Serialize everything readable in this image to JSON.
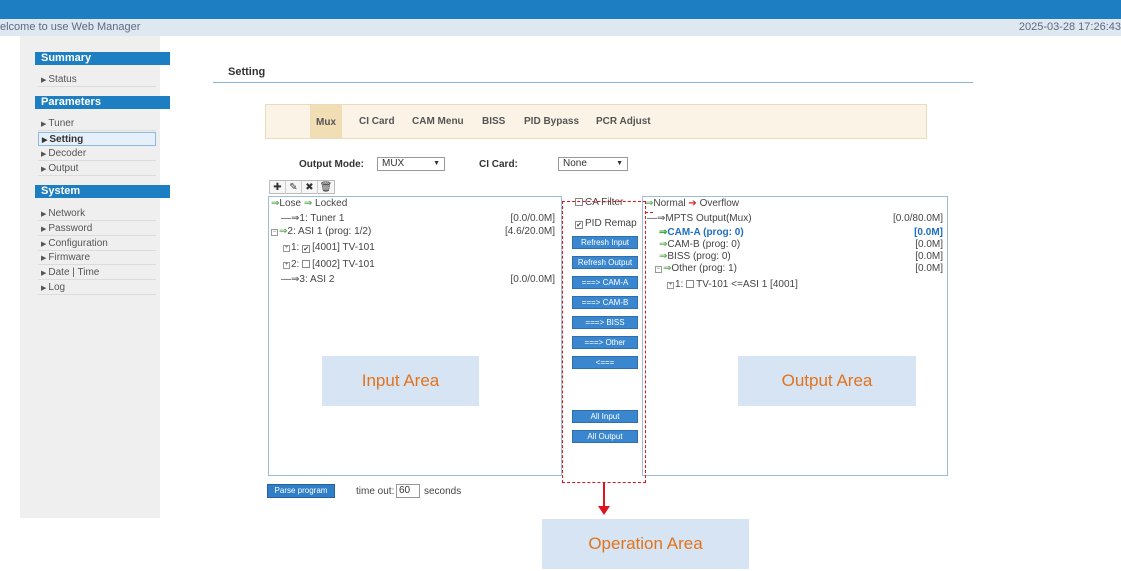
{
  "header": {
    "welcome": "elcome to use Web Manager",
    "datetime": "2025-03-28 17:26:43",
    "accent": "#1d7fc1"
  },
  "sidebar": {
    "summary_title": "Summary",
    "summary_items": [
      "Status"
    ],
    "parameters_title": "Parameters",
    "parameters_items": [
      "Tuner",
      "Setting",
      "Decoder",
      "Output"
    ],
    "system_title": "System",
    "system_items": [
      "Network",
      "Password",
      "Configuration",
      "Firmware",
      "Date | Time",
      "Log"
    ],
    "active_item": "Setting"
  },
  "page": {
    "title": "Setting"
  },
  "tabs": [
    "Mux",
    "CI Card",
    "CAM Menu",
    "BISS",
    "PID Bypass",
    "PCR Adjust"
  ],
  "active_tab": "Mux",
  "form": {
    "output_mode_label": "Output Mode:",
    "output_mode_value": "MUX",
    "ci_card_label": "CI Card:",
    "ci_card_value": "None"
  },
  "toolbar_icons": [
    "plus-icon",
    "pencil-icon",
    "delete-icon",
    "trash-icon"
  ],
  "input_area": {
    "legend_lose": "Lose",
    "legend_locked": "Locked",
    "rows": [
      {
        "label": "1: Tuner 1",
        "rate": "[0.0/0.0M]"
      },
      {
        "label": "2: ASI 1 (prog: 1/2)",
        "rate": "[4.6/20.0M]"
      },
      {
        "label": "[4001] TV-101",
        "prefix": "1:",
        "checked": true
      },
      {
        "label": "[4002] TV-101",
        "prefix": "2:",
        "checked": false
      },
      {
        "label": "3: ASI 2",
        "rate": "[0.0/0.0M]"
      }
    ],
    "area_label": "Input Area"
  },
  "operation_area": {
    "ca_filter": "CA Filter",
    "pid_remap": "PID Remap",
    "buttons": [
      "Refresh Input",
      "Refresh Output",
      "===> CAM-A",
      "===> CAM-B",
      "===> BISS",
      "===> Other",
      "<===",
      "All Input",
      "All Output"
    ],
    "area_label": "Operation Area"
  },
  "output_area": {
    "legend_normal": "Normal",
    "legend_overflow": "Overflow",
    "rows": [
      {
        "label": "MPTS Output(Mux)",
        "rate": "[0.0/80.0M]"
      },
      {
        "label": "CAM-A (prog: 0)",
        "rate": "[0.0M]"
      },
      {
        "label": "CAM-B (prog: 0)",
        "rate": "[0.0M]"
      },
      {
        "label": "BISS (prog: 0)",
        "rate": "[0.0M]"
      },
      {
        "label": "Other (prog: 1)",
        "rate": "[0.0M]"
      },
      {
        "label": "TV-101 <=ASI 1 [4001]",
        "prefix": "1:"
      }
    ],
    "area_label": "Output Area"
  },
  "footer": {
    "parse_button": "Parse program",
    "timeout_label": "time out:",
    "timeout_value": "60",
    "seconds_label": "seconds"
  }
}
